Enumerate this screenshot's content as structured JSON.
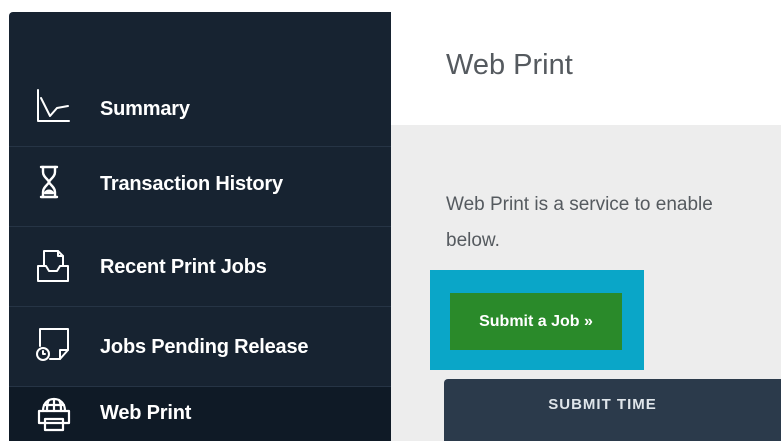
{
  "sidebar": {
    "items": [
      {
        "label": "Summary",
        "icon": "line-chart-icon",
        "active": false
      },
      {
        "label": "Transaction History",
        "icon": "hourglass-icon",
        "active": false
      },
      {
        "label": "Recent Print Jobs",
        "icon": "printer-tray-icon",
        "active": false
      },
      {
        "label": "Jobs Pending Release",
        "icon": "document-clock-icon",
        "active": false
      },
      {
        "label": "Web Print",
        "icon": "globe-printer-icon",
        "active": true
      }
    ]
  },
  "main": {
    "title": "Web Print",
    "intro_line1": "Web Print is a service to enable",
    "intro_line2": "below.",
    "submit_button": "Submit a Job »",
    "table": {
      "columns": [
        "SUBMIT TIME"
      ]
    }
  },
  "colors": {
    "sidebar_bg": "#172331",
    "sidebar_active_bg": "#0f1a26",
    "button_green": "#2a8a2a",
    "highlight_cyan": "#0aa6c8",
    "table_header_bg": "#2b3a4b",
    "content_bg": "#ededed"
  }
}
